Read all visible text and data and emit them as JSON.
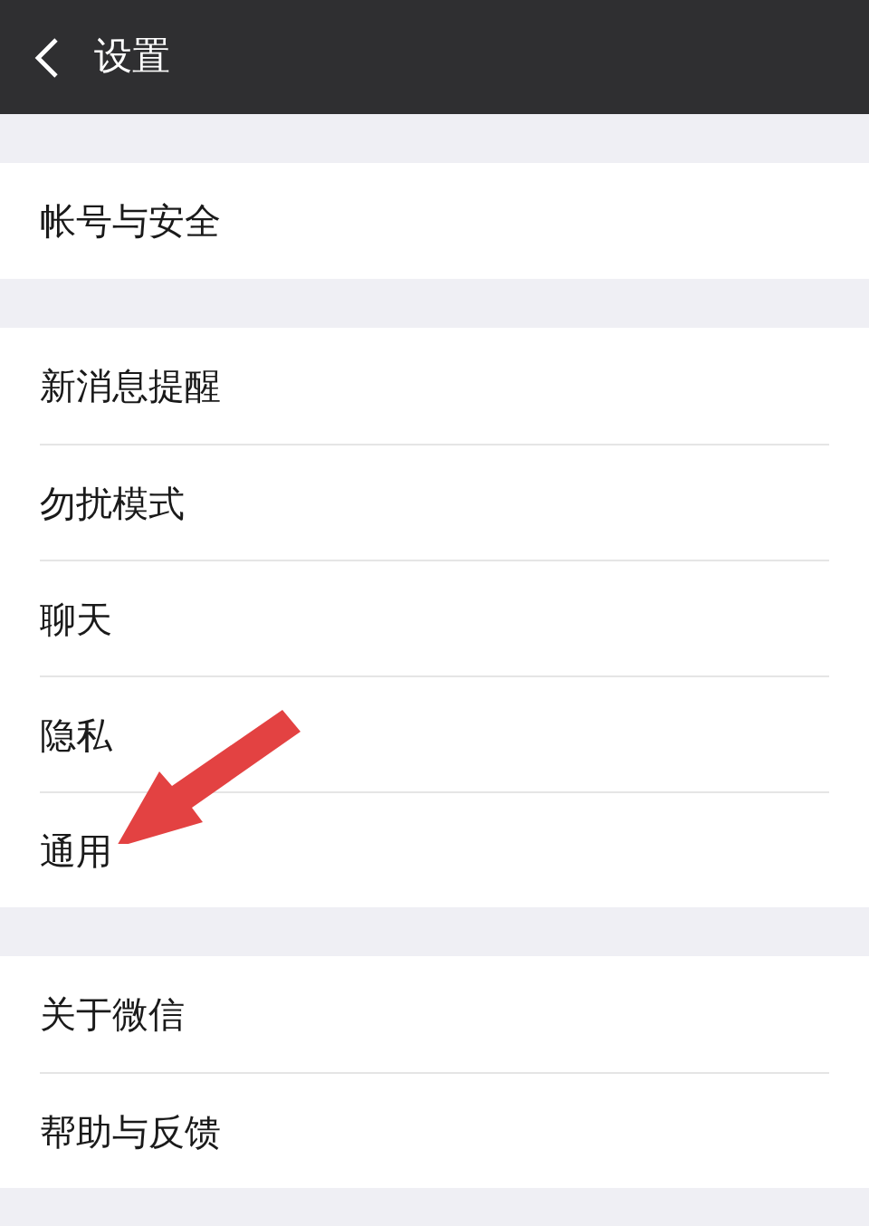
{
  "header": {
    "title": "设置"
  },
  "sections": [
    {
      "items": [
        {
          "label": "帐号与安全"
        }
      ]
    },
    {
      "items": [
        {
          "label": "新消息提醒"
        },
        {
          "label": "勿扰模式"
        },
        {
          "label": "聊天"
        },
        {
          "label": "隐私"
        },
        {
          "label": "通用"
        }
      ]
    },
    {
      "items": [
        {
          "label": "关于微信"
        },
        {
          "label": "帮助与反馈"
        }
      ]
    }
  ]
}
